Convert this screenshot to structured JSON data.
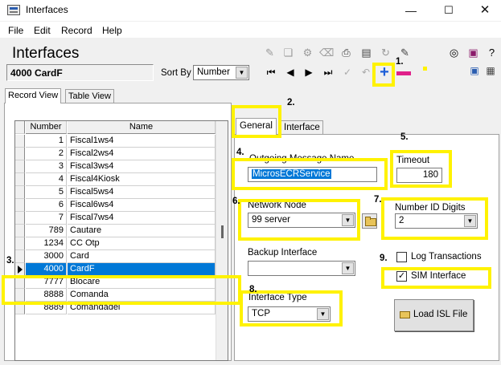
{
  "window": {
    "title": "Interfaces"
  },
  "menu": [
    "File",
    "Edit",
    "Record",
    "Help"
  ],
  "header": {
    "title": "Interfaces",
    "current_record": "4000 CardF",
    "sort_by_label": "Sort By",
    "sort_by_value": "Number"
  },
  "tabs": {
    "record_view": "Record View",
    "table_view": "Table View"
  },
  "grid": {
    "columns": [
      "Number",
      "Name"
    ],
    "rows": [
      {
        "number": "1",
        "name": "Fiscal1ws4"
      },
      {
        "number": "2",
        "name": "Fiscal2ws4"
      },
      {
        "number": "3",
        "name": "Fiscal3ws4"
      },
      {
        "number": "4",
        "name": "Fiscal4Kiosk"
      },
      {
        "number": "5",
        "name": "Fiscal5ws4"
      },
      {
        "number": "6",
        "name": "Fiscal6ws4"
      },
      {
        "number": "7",
        "name": "Fiscal7ws4"
      },
      {
        "number": "789",
        "name": "Cautare"
      },
      {
        "number": "1234",
        "name": "CC Otp"
      },
      {
        "number": "3000",
        "name": "Card"
      },
      {
        "number": "4000",
        "name": "CardF"
      },
      {
        "number": "7777",
        "name": "Blocare"
      },
      {
        "number": "8888",
        "name": "Comanda"
      },
      {
        "number": "8889",
        "name": "Comandadel"
      }
    ]
  },
  "detail_tabs": {
    "general": "General",
    "interface": "Interface"
  },
  "form": {
    "outgoing_message_name_label": "Outgoing Message Name",
    "outgoing_message_name_value": "MicrosECRService",
    "timeout_label": "Timeout",
    "timeout_value": "180",
    "network_node_label": "Network Node",
    "network_node_value": "99  server",
    "number_id_digits_label": "Number ID Digits",
    "number_id_digits_value": "2",
    "backup_interface_label": "Backup Interface",
    "backup_interface_value": "",
    "log_transactions_label": "Log Transactions",
    "log_transactions_checked": false,
    "sim_interface_label": "SIM Interface",
    "sim_interface_checked": true,
    "interface_type_label": "Interface Type",
    "interface_type_value": "TCP",
    "load_isl_label": "Load ISL File"
  },
  "annotations": [
    "1.",
    "2.",
    "3.",
    "4.",
    "5.",
    "6.",
    "7.",
    "8.",
    "9."
  ],
  "colors": {
    "highlight": "#fff200",
    "selection": "#0078d7",
    "add_icon": "#1e5fd8",
    "delete_icon": "#e0208a"
  },
  "icons": [
    "app-icon",
    "minimize-icon",
    "maximize-icon",
    "close-icon",
    "new-record-icon",
    "copy-icon",
    "paste-icon",
    "delete-icon",
    "print-icon",
    "link-icon",
    "binoculars-icon",
    "book-icon",
    "help-icon",
    "first-icon",
    "prev-icon",
    "next-icon",
    "last-icon",
    "add-icon",
    "remove-icon",
    "folder-icon"
  ]
}
